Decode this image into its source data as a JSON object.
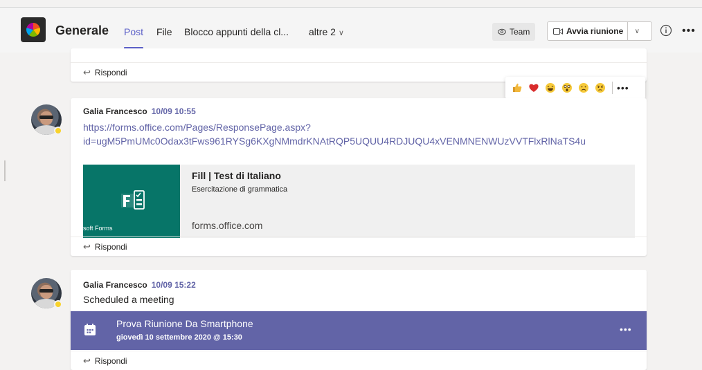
{
  "header": {
    "channel_name": "Generale",
    "tabs": [
      {
        "label": "Post"
      },
      {
        "label": "File"
      },
      {
        "label": "Blocco appunti della cl..."
      },
      {
        "label": "altre 2"
      }
    ],
    "team_button": "Team",
    "meeting_button": "Avvia riunione"
  },
  "posts": [
    {
      "reply_label": "Rispondi"
    },
    {
      "author": "Galia Francesco",
      "time": "10/09 10:55",
      "link_line1": "https://forms.office.com/Pages/ResponsePage.aspx?",
      "link_line2": "id=ugM5PmUMc0Odax3tFws961RYSg6KXgNMmdrKNAtRQP5UQUU4RDJUQU4xVENMNENWUzVVTFlxRlNaTS4u",
      "preview": {
        "thumb_caption": "soft Forms",
        "title": "Fill | Test di Italiano",
        "description": "Esercitazione di grammatica",
        "domain": "forms.office.com"
      },
      "reply_label": "Rispondi"
    },
    {
      "author": "Galia Francesco",
      "time": "10/09 15:22",
      "message": "Scheduled a meeting",
      "meeting": {
        "title": "Prova Riunione Da Smartphone",
        "date": "giovedì 10 settembre 2020 @ 15:30"
      },
      "reply_label": "Rispondi"
    }
  ],
  "reactions": [
    "like-icon",
    "heart-icon",
    "laugh-icon",
    "surprised-icon",
    "sad-icon",
    "angry-icon"
  ],
  "colors": {
    "accent": "#6264a7",
    "forms_green": "#077568",
    "presence_away": "#f8d22a"
  }
}
